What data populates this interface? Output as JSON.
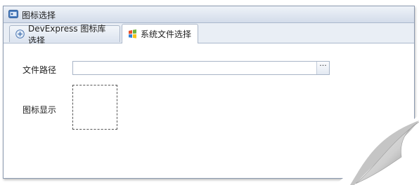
{
  "window": {
    "title": "图标选择",
    "title_icon": "window-app-icon"
  },
  "tabs": [
    {
      "label": "DevExpress 图标库选择",
      "icon": "devexpress-icon",
      "selected": false
    },
    {
      "label": "系统文件选择",
      "icon": "windows-logo-icon",
      "selected": true
    }
  ],
  "form": {
    "path_label": "文件路径",
    "path_value": "",
    "browse_button": "···",
    "preview_label": "图标显示"
  },
  "colors": {
    "accent_border": "#8c9ab0",
    "tab_border": "#aab6c8"
  }
}
